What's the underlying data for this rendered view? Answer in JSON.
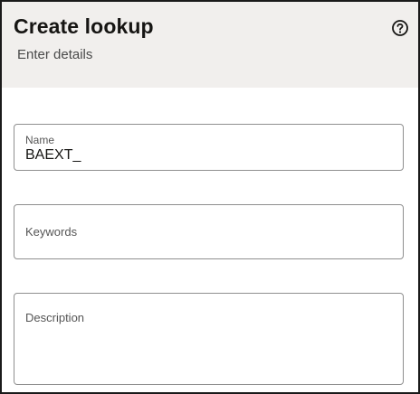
{
  "dialog": {
    "title": "Create lookup",
    "subtitle": "Enter details",
    "help_icon": "help-circle-icon"
  },
  "form": {
    "name": {
      "label": "Name",
      "value": "BAEXT_"
    },
    "keywords": {
      "label": "Keywords",
      "value": ""
    },
    "description": {
      "label": "Description",
      "value": ""
    }
  }
}
